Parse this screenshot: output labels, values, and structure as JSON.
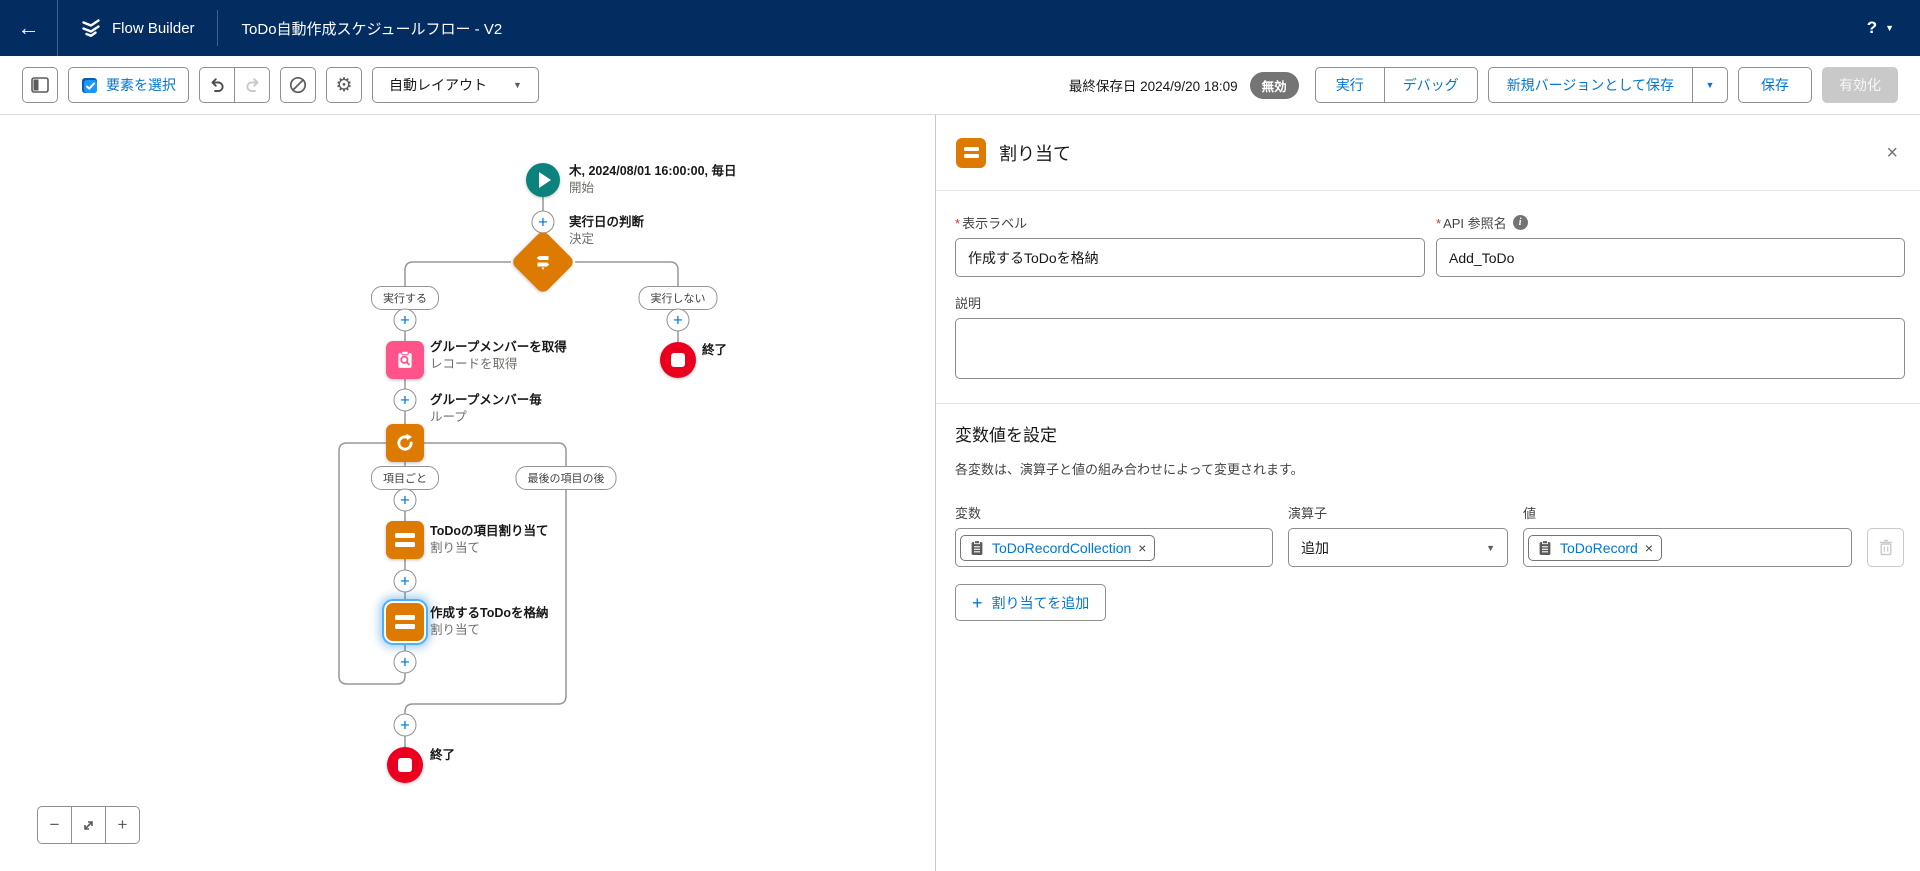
{
  "colors": {
    "navbar_bg": "#032d60",
    "accent_blue": "#0176d3",
    "assignment_orange": "#dd7a01",
    "get_records_pink": "#ff538a",
    "start_teal": "#0b827c",
    "end_red": "#ea001e",
    "badge_gray": "#747474"
  },
  "navbar": {
    "app_name": "Flow Builder",
    "doc_title": "ToDo自動作成スケジュールフロー - V2",
    "help": "?"
  },
  "toolbar": {
    "select_elements": "要素を選択",
    "auto_layout": "自動レイアウト",
    "last_saved": "最終保存日 2024/9/20 18:09",
    "status_badge": "無効",
    "run": "実行",
    "debug": "デバッグ",
    "save_as_new": "新規バージョンとして保存",
    "save": "保存",
    "activate": "有効化"
  },
  "canvas": {
    "nodes": [
      {
        "type": "start",
        "title": "木, 2024/08/01 16:00:00, 毎日",
        "subtitle": "開始"
      },
      {
        "type": "decision",
        "title": "実行日の判断",
        "subtitle": "決定"
      },
      {
        "type": "get-records",
        "title": "グループメンバーを取得",
        "subtitle": "レコードを取得"
      },
      {
        "type": "end",
        "title": "終了"
      },
      {
        "type": "loop",
        "title": "グループメンバー毎",
        "subtitle": "ループ"
      },
      {
        "type": "assignment",
        "title": "ToDoの項目割り当て",
        "subtitle": "割り当て"
      },
      {
        "type": "assignment",
        "title": "作成するToDoを格納",
        "subtitle": "割り当て",
        "selected": true
      },
      {
        "type": "end",
        "title": "終了"
      }
    ],
    "branch_labels": [
      "実行する",
      "実行しない",
      "項目ごと",
      "最後の項目の後"
    ]
  },
  "panel": {
    "title": "割り当て",
    "display_label": "表示ラベル",
    "display_value": "作成するToDoを格納",
    "api_label": "API 参照名",
    "api_value": "Add_ToDo",
    "description_label": "説明",
    "description_value": "",
    "section_heading": "変数値を設定",
    "section_description": "各変数は、演算子と値の組み合わせによって変更されます。",
    "col_variable": "変数",
    "col_operator": "演算子",
    "col_value": "値",
    "variable_pill": "ToDoRecordCollection",
    "operator_value": "追加",
    "value_pill": "ToDoRecord",
    "add_button": "割り当てを追加"
  },
  "icons": {
    "plus": "+",
    "back_arrow": "←",
    "dropdown_caret": "▼",
    "close": "×",
    "minus": "−",
    "gear": "⚙"
  }
}
